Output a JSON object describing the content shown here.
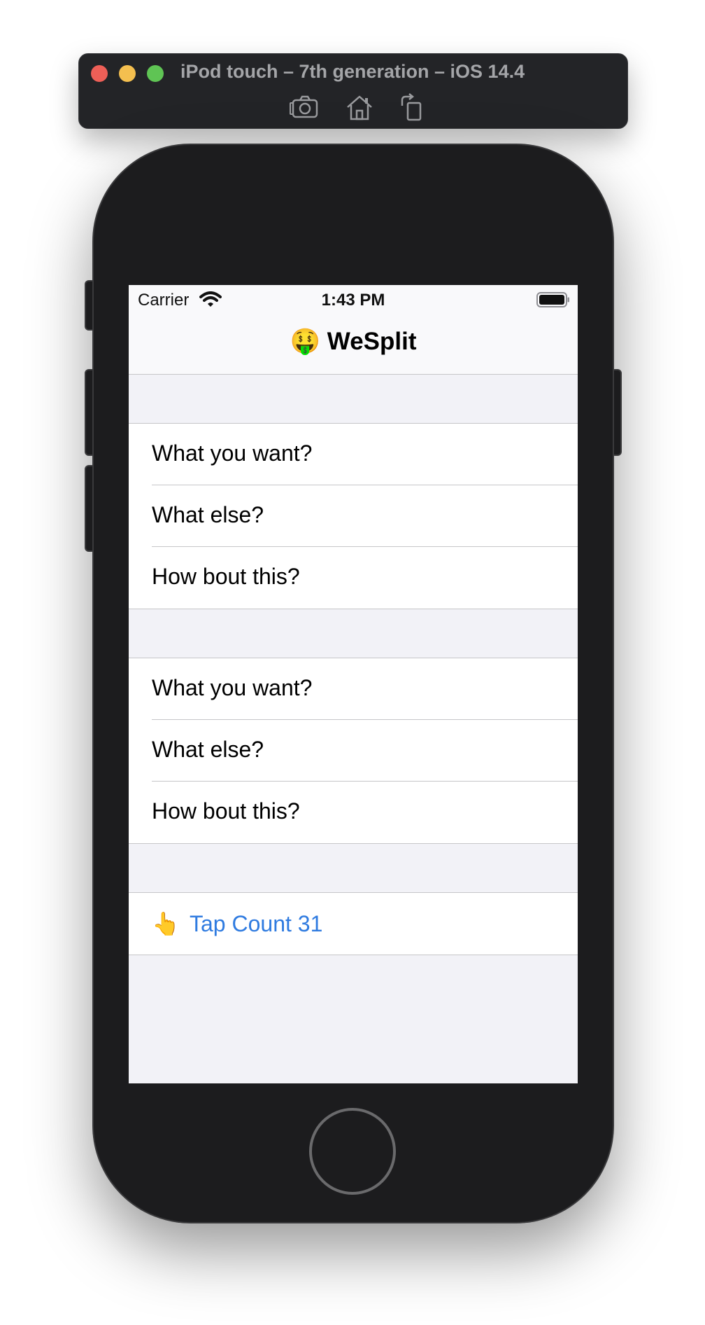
{
  "simulator": {
    "title": "iPod touch – 7th generation – iOS 14.4",
    "tools": [
      {
        "name": "screenshot",
        "icon": "camera-icon"
      },
      {
        "name": "home",
        "icon": "home-icon"
      },
      {
        "name": "rotate",
        "icon": "rotate-icon"
      }
    ],
    "colors": {
      "close": "#ee5f57",
      "minimize": "#f4bf4f",
      "zoom": "#5fc454"
    }
  },
  "status_bar": {
    "carrier": "Carrier",
    "time": "1:43 PM",
    "battery_level": 1.0
  },
  "nav": {
    "title": "🤑 WeSplit"
  },
  "sections": [
    {
      "rows": [
        {
          "label": "What you want?"
        },
        {
          "label": "What else?"
        },
        {
          "label": "How bout this?"
        }
      ]
    },
    {
      "rows": [
        {
          "label": "What you want?"
        },
        {
          "label": "What else?"
        },
        {
          "label": "How bout this?"
        }
      ]
    }
  ],
  "tap_button": {
    "emoji": "👆",
    "label": "Tap Count 31"
  },
  "colors": {
    "accent": "#2f7be0",
    "grouped_background": "#f2f2f7",
    "separator": "#c6c6c8"
  }
}
